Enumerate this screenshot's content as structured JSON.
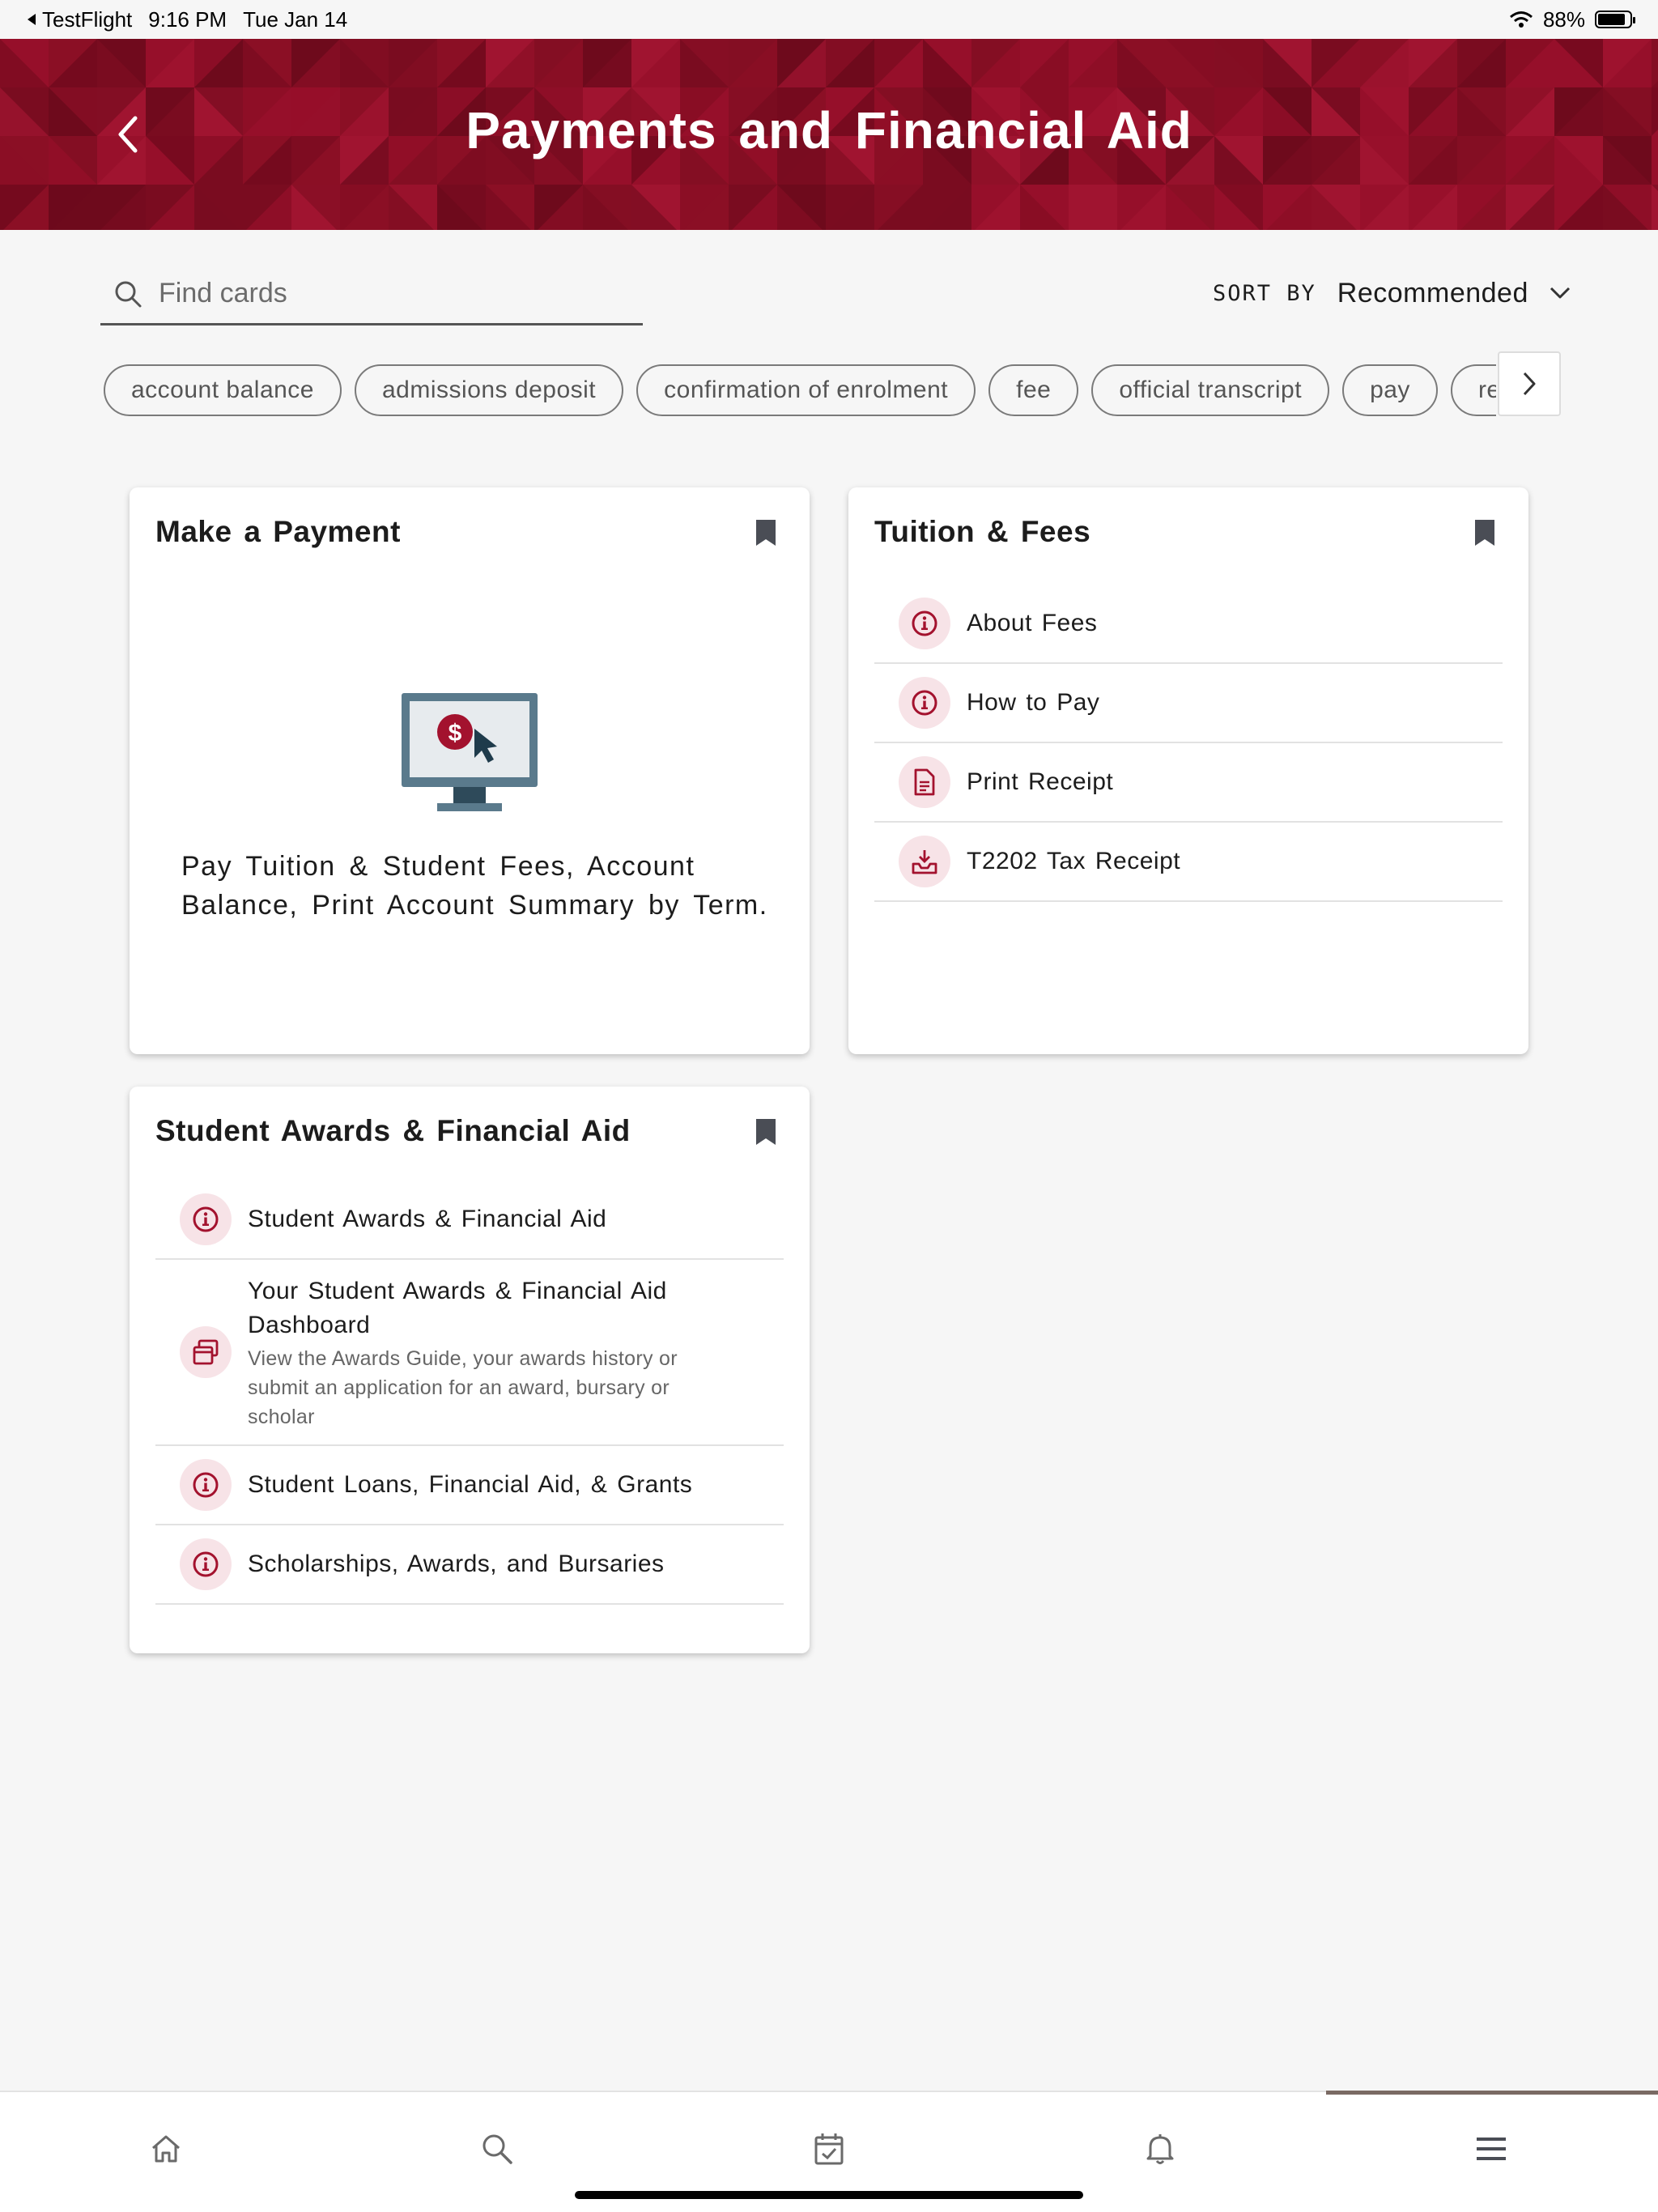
{
  "status_bar": {
    "back_app": "TestFlight",
    "time": "9:16 PM",
    "date": "Tue Jan 14",
    "battery": "88%",
    "battery_level": 0.88
  },
  "header": {
    "title": "Payments and Financial Aid",
    "back_icon": "chevron-left-icon"
  },
  "search": {
    "placeholder": "Find cards",
    "value": ""
  },
  "sort": {
    "label": "SORT BY",
    "value": "Recommended"
  },
  "chips": [
    "account balance",
    "admissions deposit",
    "confirmation of enrolment",
    "fee",
    "official transcript",
    "pay",
    "reg"
  ],
  "cards": {
    "payment": {
      "title": "Make a Payment",
      "description": "Pay Tuition & Student Fees, Account Balance, Print Account Summary by Term.",
      "illustration": "monitor-dollar-cursor-icon"
    },
    "tuition": {
      "title": "Tuition & Fees",
      "links": [
        {
          "label": "About Fees",
          "icon": "info-icon"
        },
        {
          "label": "How to Pay",
          "icon": "info-icon"
        },
        {
          "label": "Print Receipt",
          "icon": "document-icon"
        },
        {
          "label": "T2202 Tax Receipt",
          "icon": "download-tray-icon"
        }
      ]
    },
    "awards": {
      "title": "Student Awards & Financial Aid",
      "links": [
        {
          "label": "Student Awards & Financial Aid",
          "icon": "info-icon"
        },
        {
          "label": "Your Student Awards & Financial Aid Dashboard",
          "sub": "View the Awards Guide, your awards history or submit an application for an award, bursary or scholar",
          "icon": "windows-icon"
        },
        {
          "label": "Student Loans, Financial Aid, & Grants",
          "icon": "info-icon"
        },
        {
          "label": "Scholarships, Awards, and Bursaries",
          "icon": "info-icon"
        }
      ]
    }
  },
  "tab_bar": {
    "tabs": [
      "home-icon",
      "search-icon",
      "calendar-check-icon",
      "bell-icon",
      "menu-icon"
    ],
    "active": "menu-icon"
  },
  "colors": {
    "brand": "#8b0f25",
    "icon_accent": "#a3122e",
    "icon_bg": "#f7e3e7"
  }
}
